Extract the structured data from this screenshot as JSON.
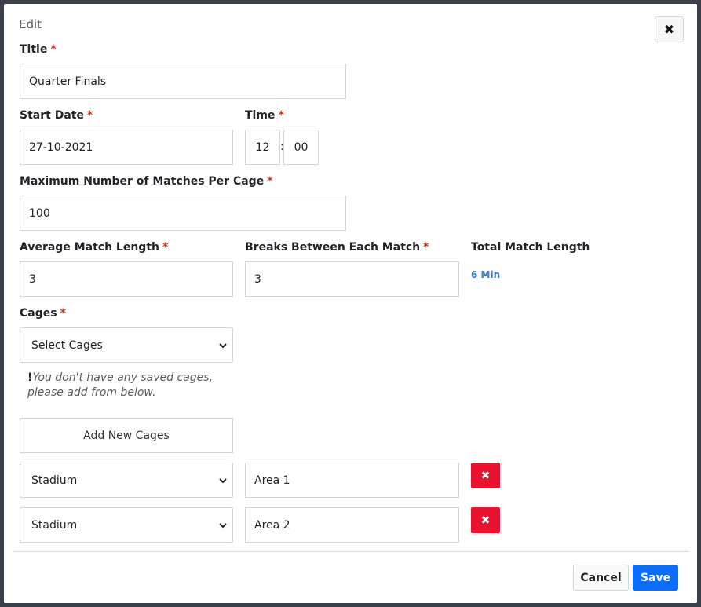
{
  "modal": {
    "title": "Edit",
    "close_icon": "✖"
  },
  "fields": {
    "title": {
      "label": "Title",
      "required": "*",
      "value": "Quarter Finals"
    },
    "start_date": {
      "label": "Start Date",
      "required": "*",
      "value": "27-10-2021"
    },
    "time": {
      "label": "Time",
      "required": "*",
      "hour": "12",
      "separator": ":",
      "minute": "00"
    },
    "max_matches": {
      "label": "Maximum Number of Matches Per Cage",
      "required": "*",
      "value": "100"
    },
    "avg_match_length": {
      "label": "Average Match Length",
      "required": "*",
      "value": "3"
    },
    "breaks": {
      "label": "Breaks Between Each Match",
      "required": "*",
      "value": "3"
    },
    "total_match_length": {
      "label": "Total Match Length",
      "value": "6 Min"
    },
    "cages": {
      "label": "Cages",
      "required": "*",
      "select_value": "Select Cages",
      "hint_mark": "!",
      "hint_line1": "You don't have any saved cages,",
      "hint_line2": "please add from below."
    }
  },
  "add_cages_label": "Add New Cages",
  "cage_rows": [
    {
      "type": "Stadium",
      "area": "Area 1"
    },
    {
      "type": "Stadium",
      "area": "Area 2"
    }
  ],
  "delete_icon": "✖",
  "footer": {
    "cancel_label": "Cancel",
    "save_label": "Save"
  },
  "colors": {
    "primary": "#0d6efd",
    "danger": "#e8132e",
    "required": "#c0392b",
    "link": "#2e7bd6"
  }
}
